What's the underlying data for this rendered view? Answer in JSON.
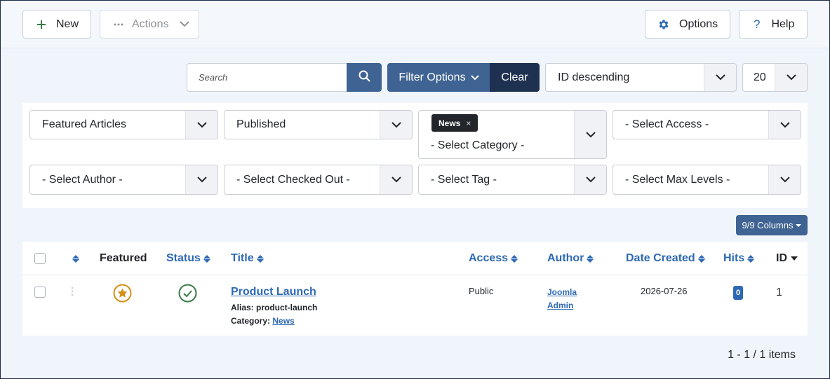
{
  "toolbar": {
    "new_label": "New",
    "actions_label": "Actions",
    "options_label": "Options",
    "help_label": "Help"
  },
  "search": {
    "placeholder": "Search",
    "filter_options_label": "Filter Options",
    "clear_label": "Clear",
    "ordering_value": "ID descending",
    "limit_value": "20"
  },
  "filters": {
    "featured": "Featured Articles",
    "published": "Published",
    "category_chip": "News",
    "category_chip_remove": "×",
    "category_placeholder": "- Select Category -",
    "access": "- Select Access -",
    "author": "- Select Author -",
    "checked_out": "- Select Checked Out -",
    "tag": "- Select Tag -",
    "max_levels": "- Select Max Levels -"
  },
  "columns_button": "9/9 Columns",
  "table": {
    "headers": {
      "featured": "Featured",
      "status": "Status",
      "title": "Title",
      "access": "Access",
      "author": "Author",
      "date_created": "Date Created",
      "hits": "Hits",
      "id": "ID"
    },
    "rows": [
      {
        "title": "Product Launch",
        "alias": "Alias: product-launch",
        "category_label": "Category:",
        "category": "News",
        "access": "Public",
        "author_line1": "Joomla",
        "author_line2": "Admin",
        "date_created": "2026-07-26",
        "hits": "0",
        "id": "1"
      }
    ]
  },
  "pagination": "1 - 1 / 1 items",
  "colors": {
    "primary": "#3f6392",
    "dark": "#1f3150",
    "link": "#2d69b3",
    "featured": "#d4901a",
    "published": "#3c7a4a"
  }
}
